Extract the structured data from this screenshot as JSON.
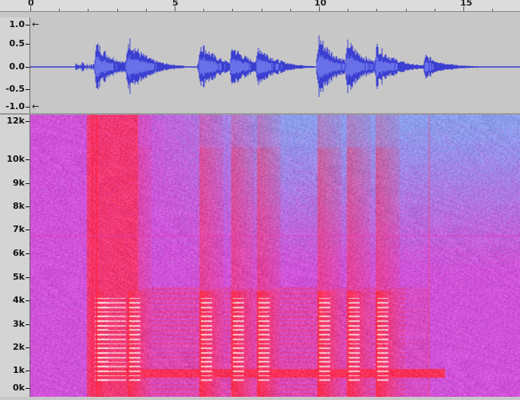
{
  "timeline": {
    "labels": [
      "0",
      "5",
      "10",
      "15"
    ]
  },
  "waveform": {
    "y_labels": [
      "1.0",
      "0.5",
      "0.0",
      "-0.5",
      "-1.0"
    ],
    "top_arrow": "←",
    "bottom_arrow": "←",
    "color": "#3b3fd0",
    "rms_color": "#6a70e8",
    "bursts_seconds": [
      2.3,
      3.4,
      5.9,
      7.0,
      7.9,
      10.0,
      11.0,
      12.0,
      13.7
    ]
  },
  "spectrogram": {
    "y_labels": [
      "12k",
      "10k",
      "9k",
      "8k",
      "7k",
      "6k",
      "5k",
      "4k",
      "3k",
      "2k",
      "1k",
      "0k"
    ],
    "note_onsets_seconds": [
      2.3,
      3.4,
      5.9,
      7.0,
      7.9,
      10.0,
      11.0,
      12.0
    ],
    "background_color": "#d34fd6",
    "hot_color": "#ff2d4a",
    "cool_color": "#7ab0f2"
  }
}
